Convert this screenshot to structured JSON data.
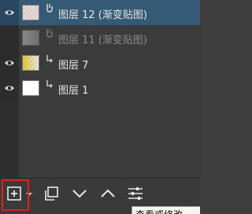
{
  "layers": [
    {
      "name": "图层 12 (渐变贴图)",
      "selected": true,
      "dim": false,
      "thumb": "checker-pink",
      "icon": "clip-link-icon"
    },
    {
      "name": "图层 11 (渐变贴图)",
      "selected": false,
      "dim": true,
      "thumb": "gray-gradient",
      "icon": "clip-link-icon"
    },
    {
      "name": "图层 7",
      "selected": false,
      "dim": false,
      "thumb": "yellow-gradient",
      "icon": "clip-arrow-icon"
    },
    {
      "name": "图层 1",
      "selected": false,
      "dim": false,
      "thumb": "white",
      "icon": "clip-arrow-icon"
    }
  ],
  "toolbar": {
    "buttons": [
      "add-layer-icon",
      "dropdown-arrow-icon",
      "duplicate-layer-icon",
      "move-down-icon",
      "move-up-icon",
      "layer-properties-icon"
    ]
  },
  "tooltip": {
    "text": "查看或修改"
  },
  "colors": {
    "panel_bg": "#3b3b3b",
    "selected_row": "#355a75",
    "highlight_box": "#e0201c",
    "text": "#e6e6e6",
    "dim_text": "#8a8a8a"
  }
}
